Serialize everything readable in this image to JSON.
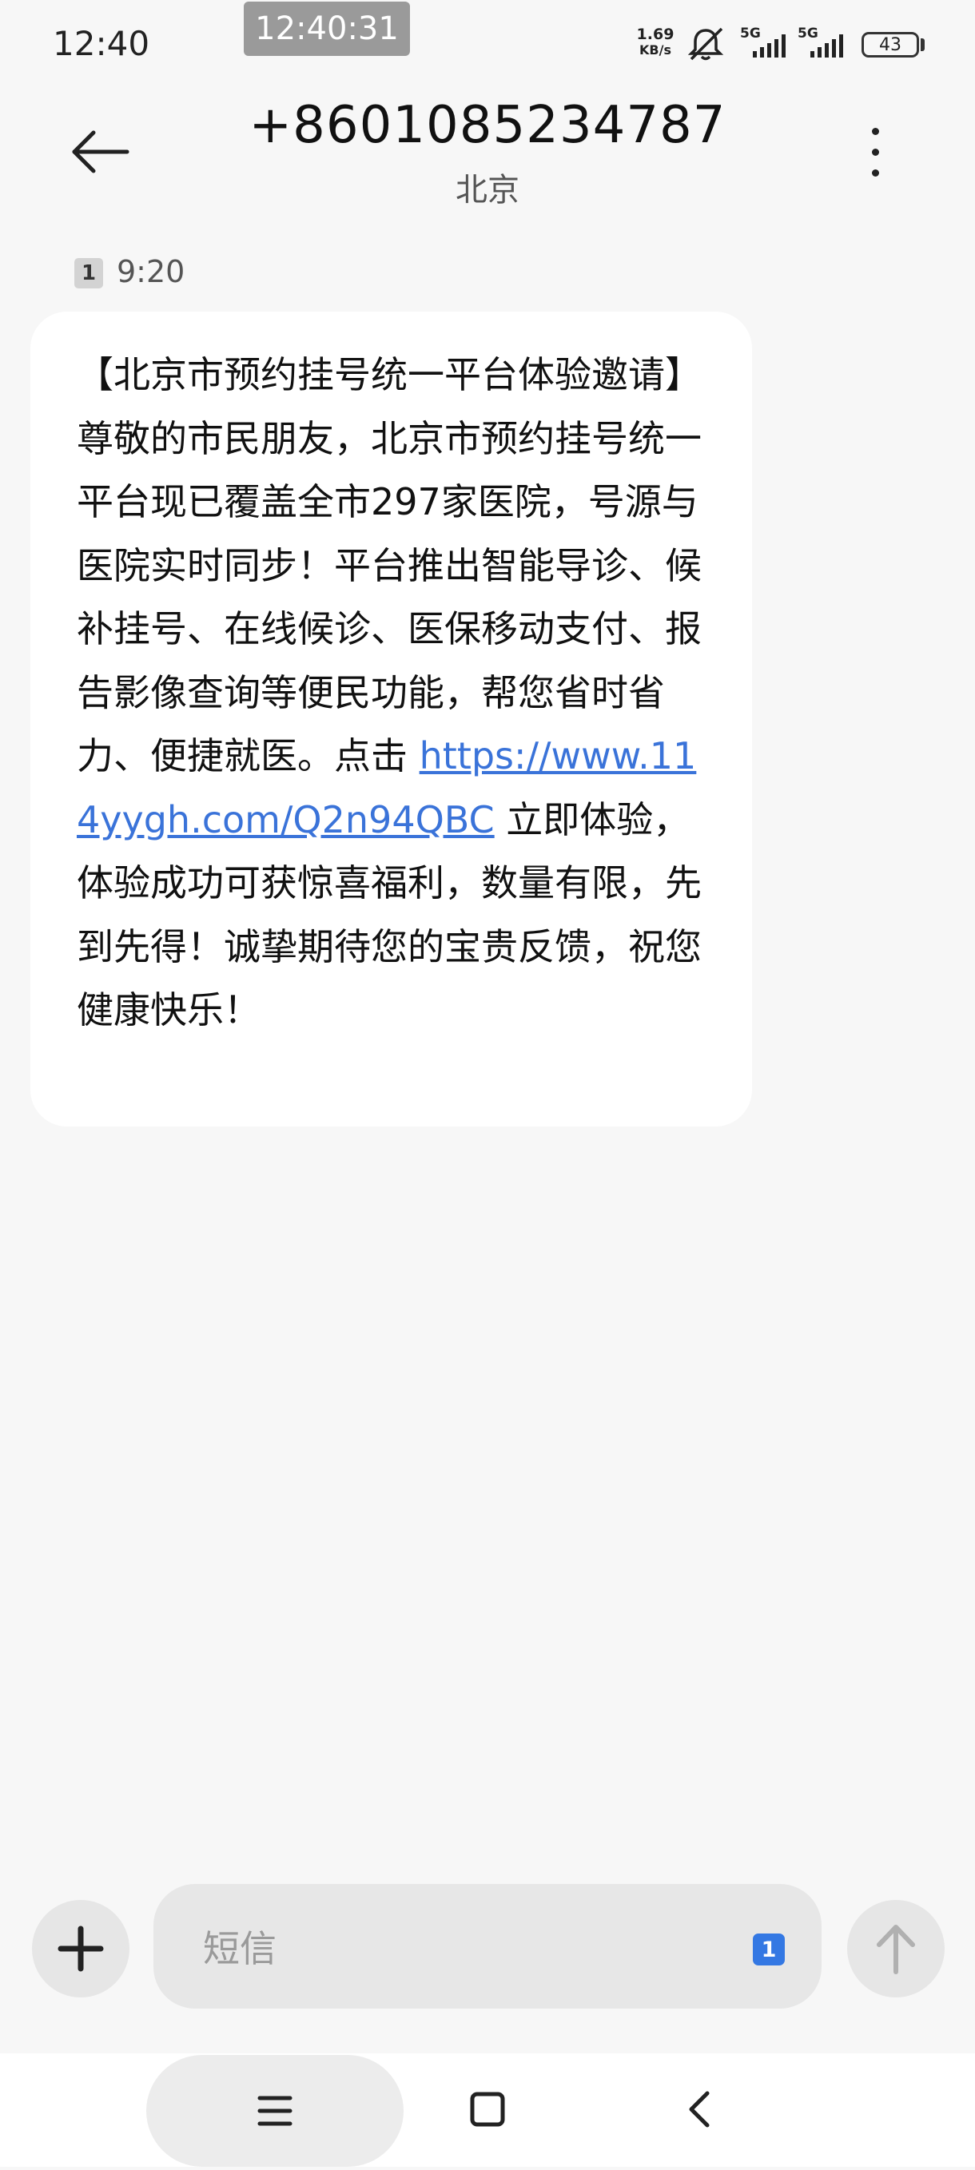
{
  "status_bar": {
    "time": "12:40",
    "screenshot_time": "12:40:31",
    "net_speed_value": "1.69",
    "net_speed_unit": "KB/s",
    "sim1_network": "5G",
    "sim2_network": "5G",
    "battery_level": "43"
  },
  "header": {
    "contact_number": "+8601085234787",
    "contact_location": "北京"
  },
  "message": {
    "sim_slot": "1",
    "time": "9:20",
    "text_before_link": "【北京市预约挂号统一平台体验邀请】尊敬的市民朋友，北京市预约挂号统一平台现已覆盖全市297家医院，号源与医院实时同步！平台推出智能导诊、候补挂号、在线候诊、医保移动支付、报告影像查询等便民功能，帮您省时省力、便捷就医。点击 ",
    "link": "https://www.114yygh.com/Q2n94QBC",
    "text_after_link": " 立即体验，体验成功可获惊喜福利，数量有限，先到先得！诚挚期待您的宝贵反馈，祝您健康快乐！"
  },
  "compose": {
    "placeholder": "短信",
    "sim_slot": "1"
  },
  "colors": {
    "background": "#f7f7f7",
    "bubble": "#ffffff",
    "link": "#3a73d9",
    "sim_badge_active": "#3478e3"
  },
  "icons": {
    "back": "arrow-left-icon",
    "menu": "more-vertical-icon",
    "add": "plus-icon",
    "send": "arrow-up-icon",
    "nav_menu": "hamburger-icon",
    "nav_home": "square-icon",
    "nav_back": "chevron-left-icon"
  }
}
